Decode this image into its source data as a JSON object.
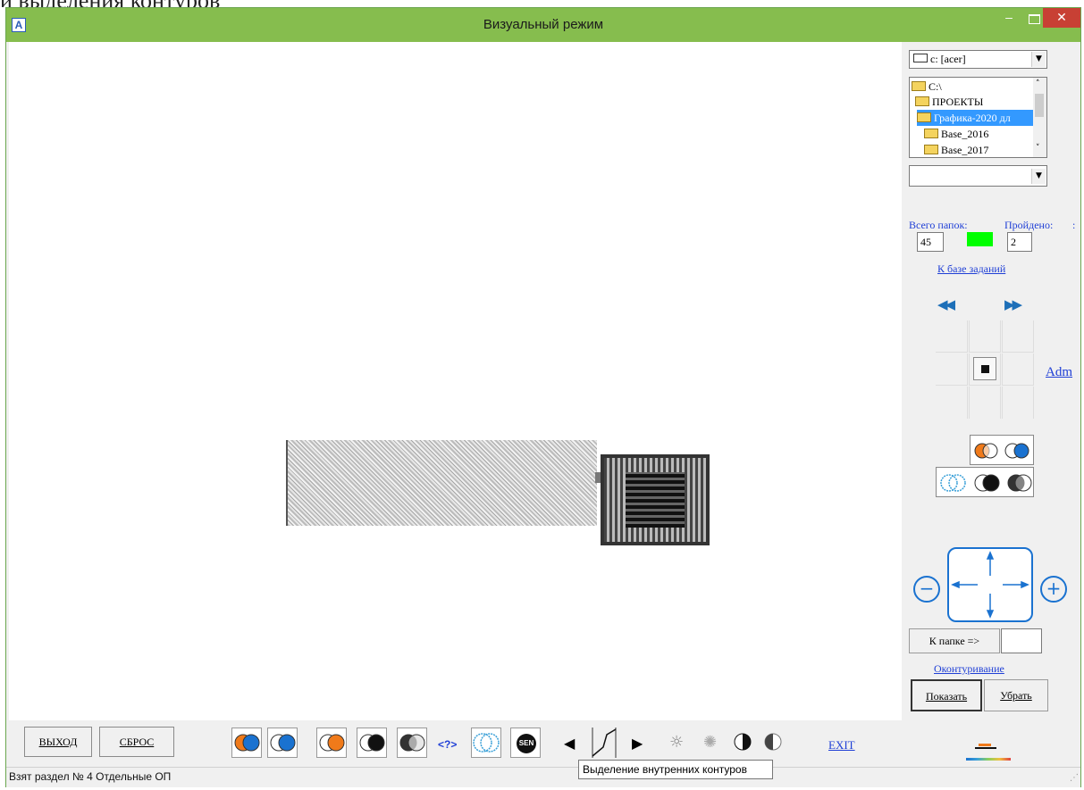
{
  "top_fragment": "и выделения контуров",
  "window": {
    "title": "Визуальный режим",
    "app_icon": "app-logo-icon",
    "minimize_label": "–",
    "close_label": "✕"
  },
  "file_panel": {
    "drive_value": "c: [acer]",
    "folders": [
      {
        "label": "C:\\",
        "level": 0
      },
      {
        "label": "ПРОЕКТЫ",
        "level": 1
      },
      {
        "label": "Графика-2020 дл",
        "level": 2
      },
      {
        "label": "Base_2016",
        "level": 3
      },
      {
        "label": "Base_2017",
        "level": 3
      }
    ],
    "selected_index": 2,
    "file_value": ""
  },
  "stats": {
    "total_folders_label": "Всего папок:",
    "total_folders_value": "45",
    "passed_label": "Пройдено:",
    "passed_suffix": ":",
    "passed_value": "2",
    "indicator_color": "#00ff00"
  },
  "links": {
    "task_base": "К базе заданий",
    "adm": "Adm",
    "contouring": "Оконтуривание",
    "exit": "EXIT"
  },
  "navigation": {
    "prev_label": "◀◀",
    "next_label": "▶▶"
  },
  "zoom": {
    "minus": "−",
    "plus": "+"
  },
  "folder_nav": {
    "label": "К папке  =>",
    "value": ""
  },
  "actions": {
    "show": "Показать",
    "hide": "Убрать"
  },
  "toolbar": {
    "exit_button": "ВЫХОД",
    "reset_button": "СБРОС",
    "help_label": "<?>",
    "sen_label": "SEN"
  },
  "tooltip": "Выделение внутренних контуров",
  "status": "Взят раздел № 4 Отдельные ОП",
  "colors": {
    "titlebar": "#86bd4e",
    "close": "#c84034",
    "link": "#1f3fd6",
    "accent_blue": "#1a72d0",
    "orange": "#f07a1a"
  }
}
